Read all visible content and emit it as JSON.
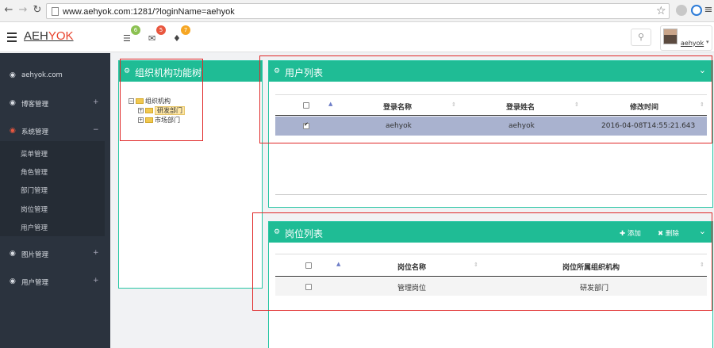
{
  "browser": {
    "url": "www.aehyok.com:1281/?loginName=aehyok"
  },
  "header": {
    "brand_part1": "AEH",
    "brand_part2": "YOK",
    "badges": [
      "6",
      "5",
      "7"
    ],
    "user_name": "aehyok",
    "colors": {
      "badge1": "#8cc152",
      "badge2": "#e9573f",
      "badge3": "#f6a623"
    }
  },
  "sidebar": {
    "items": [
      {
        "label": "aehyok.com",
        "icon": "dashboard-icon",
        "pm": ""
      },
      {
        "label": "博客管理",
        "icon": "dashboard-icon",
        "pm": "+"
      },
      {
        "label": "系统管理",
        "icon": "dashboard-icon",
        "pm": "−"
      },
      {
        "label": "图片管理",
        "icon": "dashboard-icon",
        "pm": "+"
      },
      {
        "label": "用户管理",
        "icon": "dashboard-icon",
        "pm": "+"
      }
    ],
    "sub_items": [
      "菜单管理",
      "角色管理",
      "部门管理",
      "岗位管理",
      "用户管理"
    ]
  },
  "tree_panel": {
    "title": "组织机构功能树",
    "root": "组织机构",
    "children": [
      "研发部门",
      "市场部门"
    ]
  },
  "user_panel": {
    "title": "用户列表",
    "columns": [
      "登录名称",
      "登录姓名",
      "修改时间"
    ],
    "rows": [
      {
        "login": "aehyok",
        "name": "aehyok",
        "time": "2016-04-08T14:55:21.643",
        "checked": true
      }
    ]
  },
  "post_panel": {
    "title": "岗位列表",
    "add_label": "添加",
    "delete_label": "删除",
    "columns": [
      "岗位名称",
      "岗位所属组织机构"
    ],
    "rows": [
      {
        "post": "管理岗位",
        "org": "研发部门",
        "checked": false
      }
    ]
  }
}
